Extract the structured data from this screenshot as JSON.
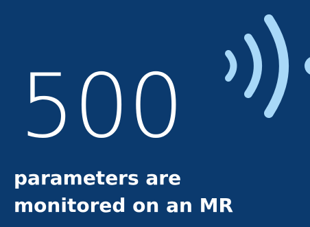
{
  "stat": {
    "number": "500",
    "caption_line1": "parameters are",
    "caption_line2": "monitored on an MR"
  },
  "icon": {
    "name": "wireless-signal-icon",
    "color": "#a8d8f8"
  },
  "colors": {
    "background": "#0b3a6e",
    "text": "#ffffff"
  }
}
